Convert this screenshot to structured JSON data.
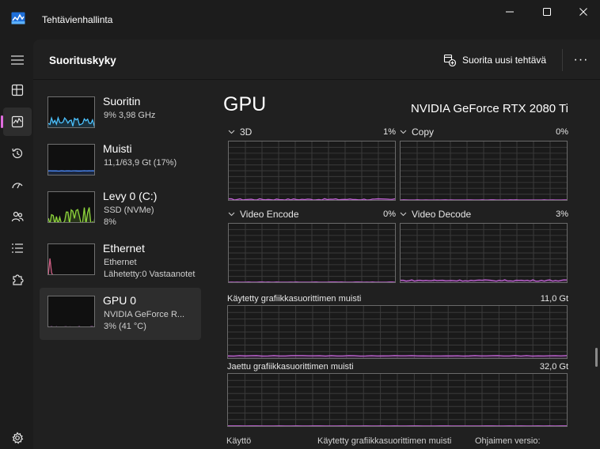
{
  "window": {
    "title": "Tehtävienhallinta"
  },
  "nav": {
    "items": [
      "menu",
      "processes",
      "performance",
      "app-history",
      "startup-apps",
      "users",
      "details",
      "services"
    ],
    "active": "performance",
    "settings": "settings"
  },
  "header": {
    "title": "Suorituskyky",
    "run_task_label": "Suorita uusi tehtävä",
    "more_label": "···"
  },
  "perf_items": [
    {
      "name": "Suoritin",
      "line1": "9%  3,98 GHz",
      "line2": "",
      "color": "#4cc2ff",
      "selected": false
    },
    {
      "name": "Muisti",
      "line1": "11,1/63,9 Gt (17%)",
      "line2": "",
      "color": "#4c8cff",
      "selected": false
    },
    {
      "name": "Levy 0 (C:)",
      "line1": "SSD (NVMe)",
      "line2": "8%",
      "color": "#8ed63c",
      "selected": false
    },
    {
      "name": "Ethernet",
      "line1": "Ethernet",
      "line2": "Lähetetty:0 Vastaanotet",
      "color": "#d25f86",
      "selected": false
    },
    {
      "name": "GPU 0",
      "line1": "NVIDIA GeForce R...",
      "line2": "3%  (41 °C)",
      "color": "#c464d8",
      "selected": true
    }
  ],
  "gpu": {
    "title": "GPU",
    "model": "NVIDIA GeForce RTX 2080 Ti",
    "engines": [
      {
        "label": "3D",
        "percent": "1%",
        "value": 1
      },
      {
        "label": "Copy",
        "percent": "0%",
        "value": 0
      },
      {
        "label": "Video Encode",
        "percent": "0%",
        "value": 0
      },
      {
        "label": "Video Decode",
        "percent": "3%",
        "value": 3
      }
    ],
    "dedicated_memory": {
      "label": "Käytetty grafiikkasuorittimen muisti",
      "value": "11,0 Gt"
    },
    "shared_memory": {
      "label": "Jaettu grafiikkasuorittimen muisti",
      "value": "32,0 Gt"
    },
    "stats": {
      "usage_label": "Käyttö",
      "dedicated_label": "Käytetty grafiikkasuorittimen muisti",
      "driver_label": "Ohjaimen versio:"
    },
    "graph_color": "#c464d8"
  }
}
